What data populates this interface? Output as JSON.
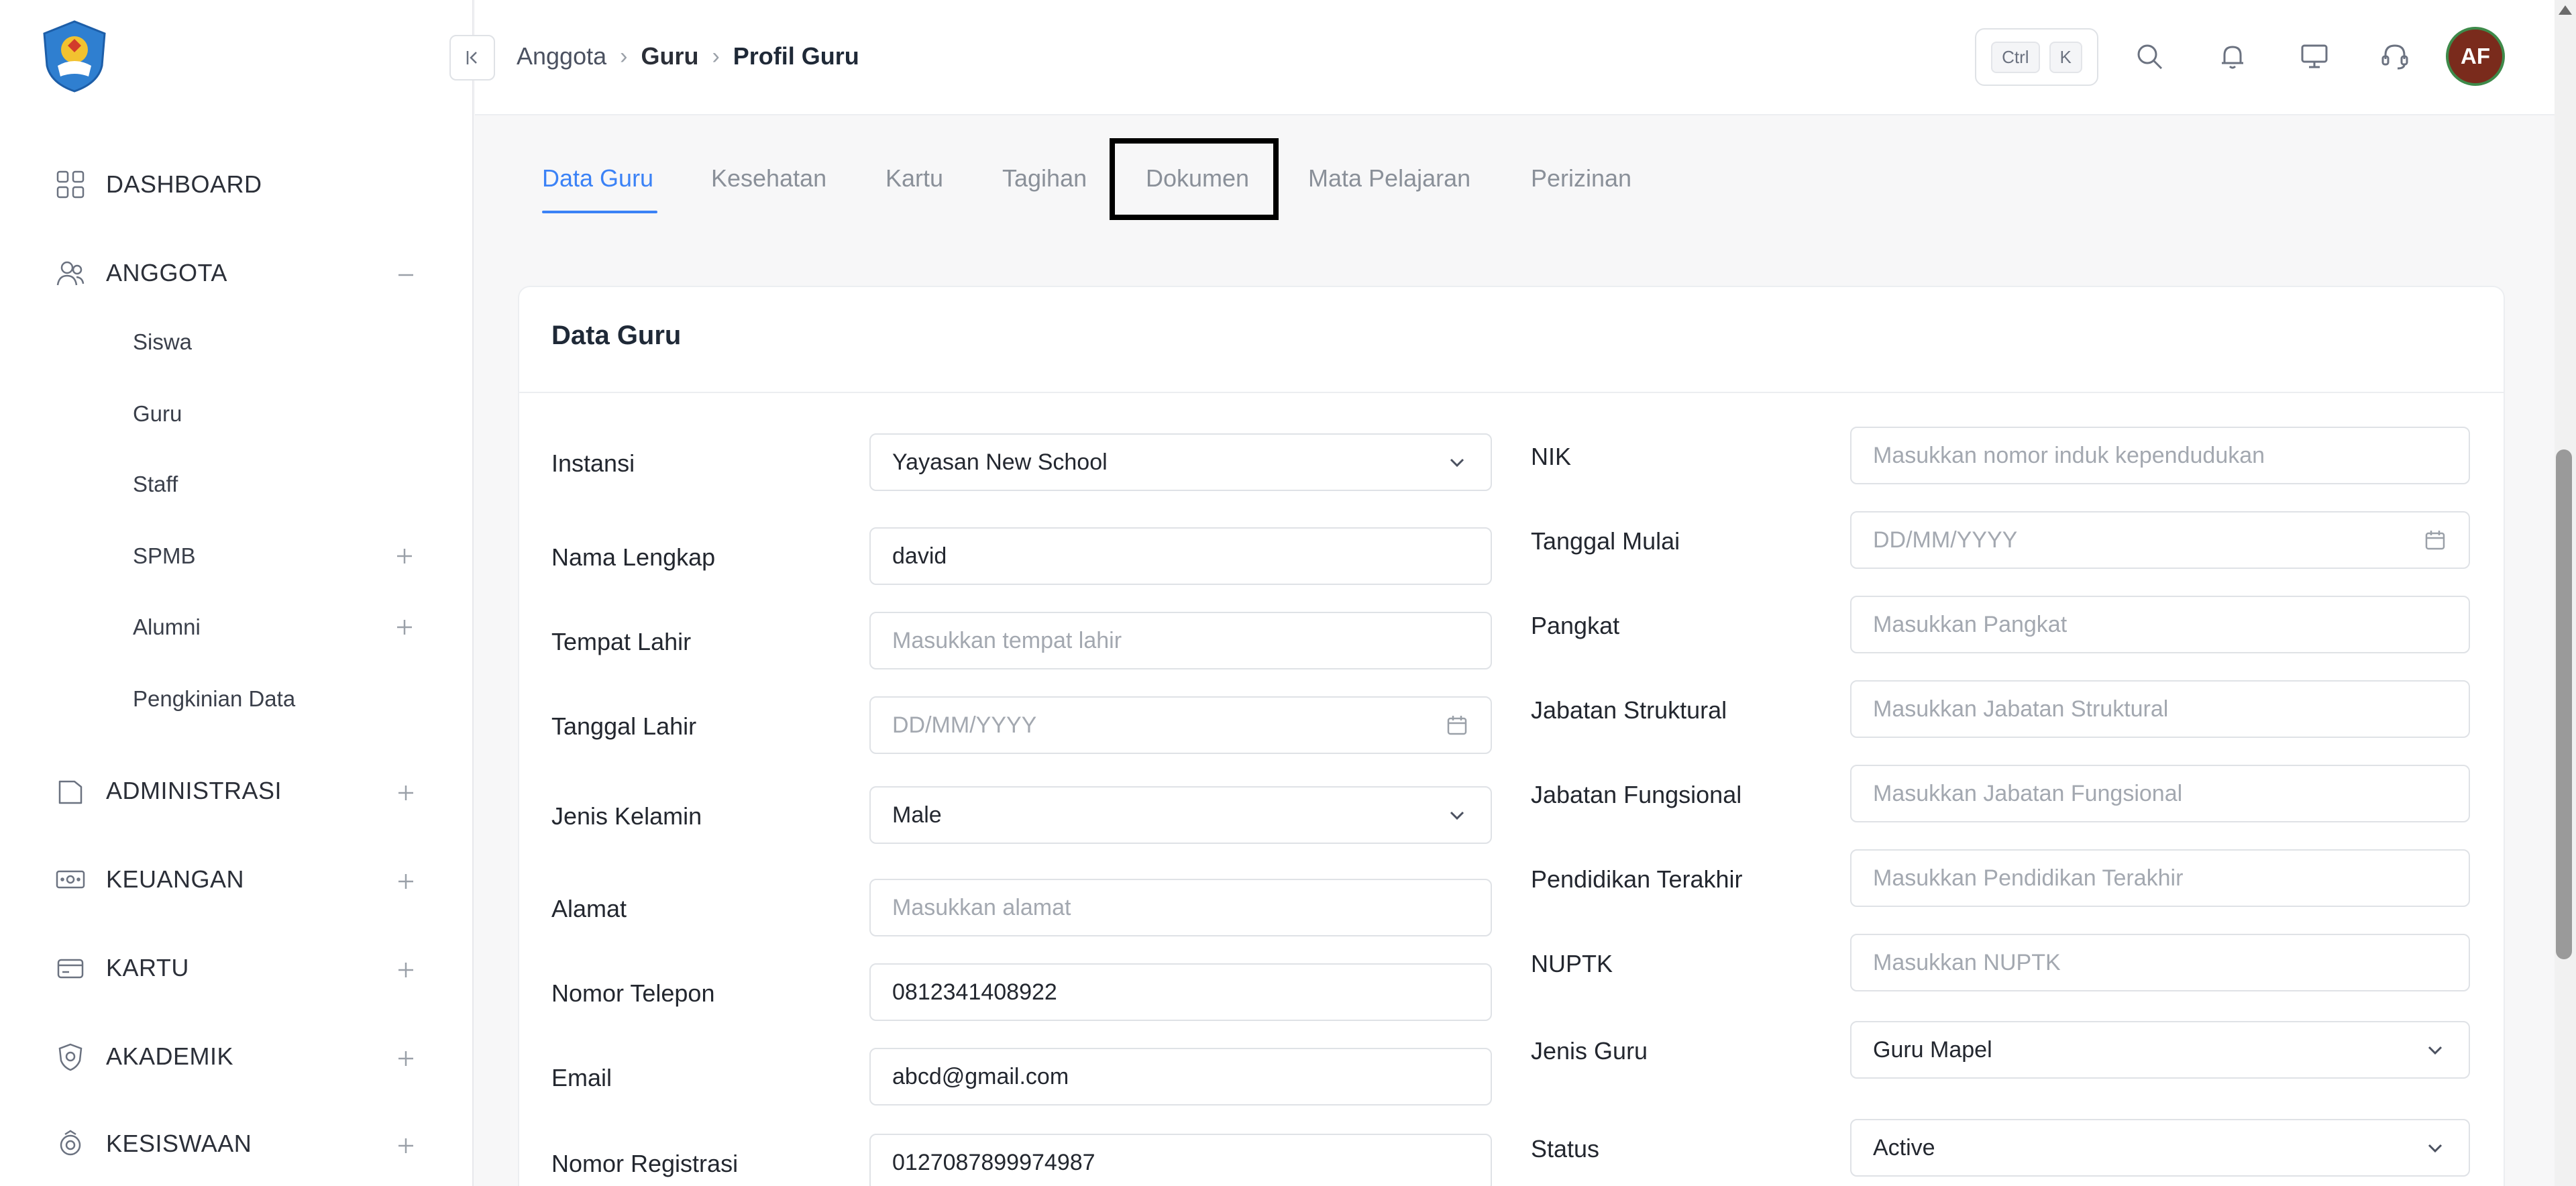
{
  "sidebar": {
    "nav": [
      {
        "label": "DASHBOARD",
        "icon": "dashboard-grid-icon"
      },
      {
        "label": "ANGGOTA",
        "icon": "users-icon",
        "expanded": true
      },
      {
        "label": "ADMINISTRASI",
        "icon": "folder-icon"
      },
      {
        "label": "KEUANGAN",
        "icon": "money-icon"
      },
      {
        "label": "KARTU",
        "icon": "card-icon"
      },
      {
        "label": "AKADEMIK",
        "icon": "academic-badge-icon"
      },
      {
        "label": "KESISWAAN",
        "icon": "student-icon"
      }
    ],
    "anggota_sub": [
      {
        "label": "Siswa"
      },
      {
        "label": "Guru"
      },
      {
        "label": "Staff"
      },
      {
        "label": "SPMB"
      },
      {
        "label": "Alumni"
      },
      {
        "label": "Pengkinian Data"
      }
    ]
  },
  "header": {
    "breadcrumb": [
      "Anggota",
      "Guru",
      "Profil Guru"
    ],
    "shortcut": [
      "Ctrl",
      "K"
    ],
    "avatar_initials": "AF",
    "accent": "#3b82f6"
  },
  "tabs": [
    {
      "label": "Data Guru",
      "active": true
    },
    {
      "label": "Kesehatan"
    },
    {
      "label": "Kartu"
    },
    {
      "label": "Tagihan"
    },
    {
      "label": "Dokumen"
    },
    {
      "label": "Mata Pelajaran"
    },
    {
      "label": "Perizinan"
    }
  ],
  "card": {
    "title": "Data Guru",
    "left": [
      {
        "label": "Instansi",
        "value": "Yayasan New School",
        "kind": "select"
      },
      {
        "label": "Nama Lengkap",
        "value": "david",
        "kind": "text"
      },
      {
        "label": "Tempat Lahir",
        "placeholder": "Masukkan tempat lahir",
        "kind": "text"
      },
      {
        "label": "Tanggal Lahir",
        "placeholder": "DD/MM/YYYY",
        "kind": "date"
      },
      {
        "label": "Jenis Kelamin",
        "value": "Male",
        "kind": "select"
      },
      {
        "label": "Alamat",
        "placeholder": "Masukkan alamat",
        "kind": "text"
      },
      {
        "label": "Nomor Telepon",
        "value": "0812341408922",
        "kind": "text"
      },
      {
        "label": "Email",
        "value": "abcd@gmail.com",
        "kind": "text"
      },
      {
        "label": "Nomor Registrasi",
        "value": "0127087899974987",
        "kind": "text"
      }
    ],
    "right": [
      {
        "label": "NIK",
        "placeholder": "Masukkan nomor induk kependudukan",
        "kind": "text"
      },
      {
        "label": "Tanggal Mulai",
        "placeholder": "DD/MM/YYYY",
        "kind": "date"
      },
      {
        "label": "Pangkat",
        "placeholder": "Masukkan Pangkat",
        "kind": "text"
      },
      {
        "label": "Jabatan Struktural",
        "placeholder": "Masukkan Jabatan Struktural",
        "kind": "text"
      },
      {
        "label": "Jabatan Fungsional",
        "placeholder": "Masukkan Jabatan Fungsional",
        "kind": "text"
      },
      {
        "label": "Pendidikan Terakhir",
        "placeholder": "Masukkan Pendidikan Terakhir",
        "kind": "text"
      },
      {
        "label": "NUPTK",
        "placeholder": "Masukkan NUPTK",
        "kind": "text"
      },
      {
        "label": "Jenis Guru",
        "value": "Guru Mapel",
        "kind": "select"
      },
      {
        "label": "Status",
        "value": "Active",
        "kind": "select"
      }
    ]
  }
}
